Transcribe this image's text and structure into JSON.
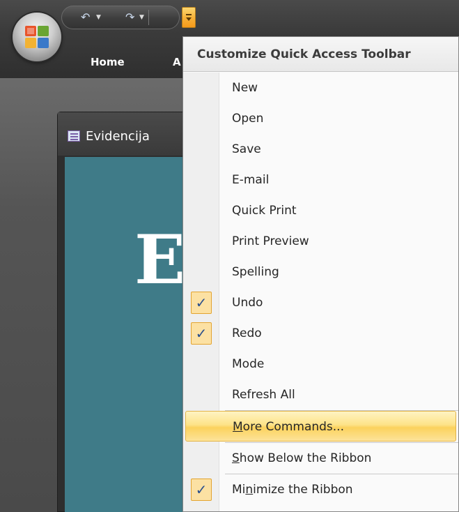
{
  "app": {
    "ribbon_tabs": [
      "Home",
      "A"
    ],
    "document_title": "Evidencija",
    "document_big_letter": "E"
  },
  "quick_access_toolbar": {
    "undo_icon": "undo-icon",
    "redo_icon": "redo-icon",
    "customize_icon": "customize-qat-icon"
  },
  "menu": {
    "header": "Customize Quick Access Toolbar",
    "items": [
      {
        "label": "New",
        "checked": false
      },
      {
        "label": "Open",
        "checked": false
      },
      {
        "label": "Save",
        "checked": false
      },
      {
        "label": "E-mail",
        "checked": false
      },
      {
        "label": "Quick Print",
        "checked": false
      },
      {
        "label": "Print Preview",
        "checked": false
      },
      {
        "label": "Spelling",
        "checked": false
      },
      {
        "label": "Undo",
        "checked": true
      },
      {
        "label": "Redo",
        "checked": true
      },
      {
        "label": "Mode",
        "checked": false
      },
      {
        "label": "Refresh All",
        "checked": false
      }
    ],
    "more_commands": {
      "label": "More Commands...",
      "accel_char": "M",
      "highlighted": true
    },
    "show_below": {
      "label": "Show Below the Ribbon",
      "accel_char": "S"
    },
    "minimize": {
      "label": "Minimize the Ribbon",
      "accel_char": "n",
      "checked": true
    }
  },
  "colors": {
    "accent_orange": "#f7b23a",
    "check_blue": "#2b4f8c",
    "doc_body": "#3f7b88"
  }
}
